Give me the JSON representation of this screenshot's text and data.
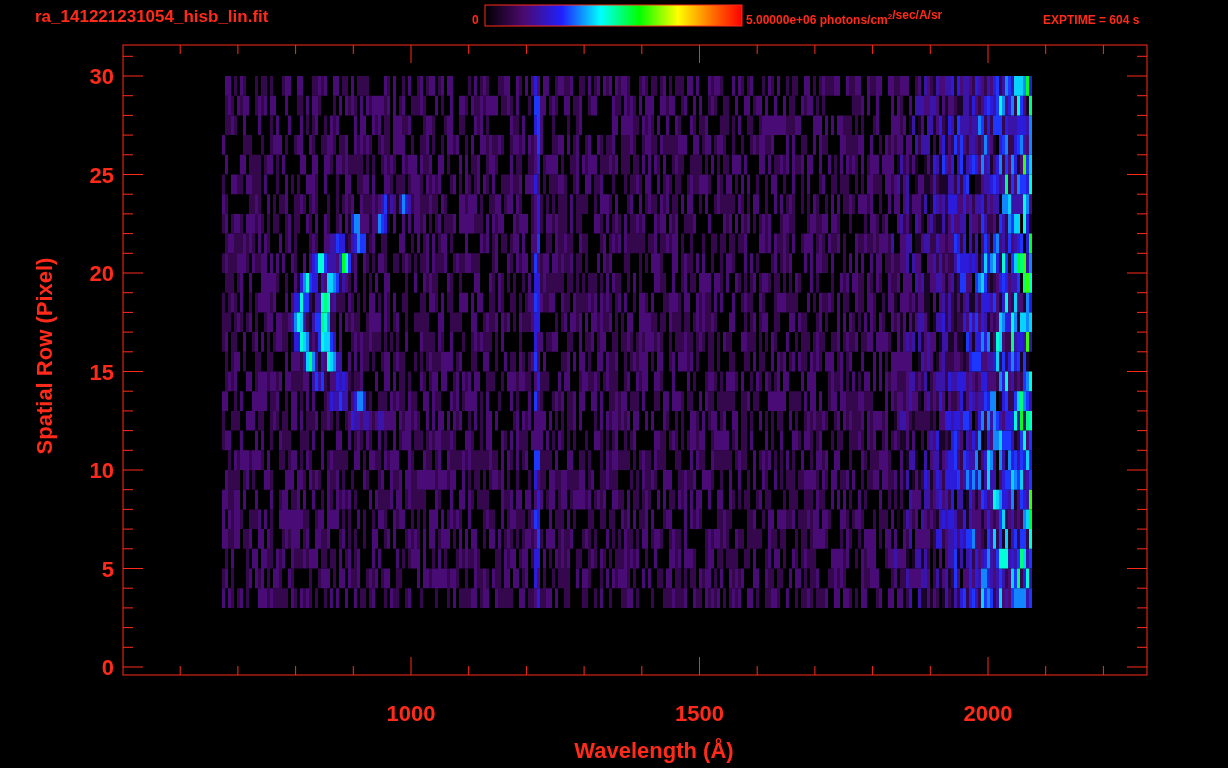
{
  "title": "ra_141221231054_hisb_lin.fit",
  "colorbar": {
    "min_label": "0",
    "max_label": "5.00000e+06 photons/cm$^{2}$/sec/A/sr"
  },
  "exposure": "EXPTIME = 604 s",
  "plot": {
    "x_axis": {
      "label": "Wavelength (Å)",
      "ticks": [
        "1000",
        "1500",
        "2000"
      ]
    },
    "y_axis": {
      "label": "Spatial Row (Pixel)",
      "ticks": [
        "30",
        "25",
        "20",
        "15",
        "10",
        "5",
        "0"
      ]
    }
  }
}
